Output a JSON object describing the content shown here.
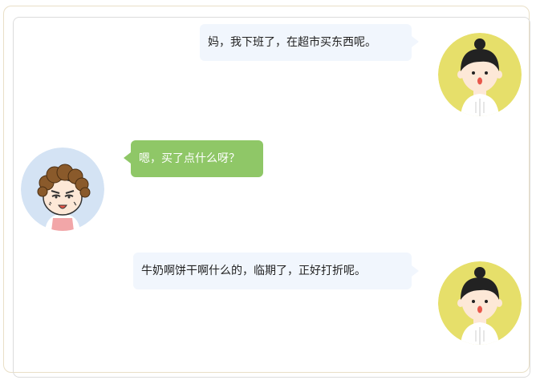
{
  "messages": [
    {
      "sender": "daughter",
      "side": "right",
      "text": "妈，我下班了，在超市买东西呢。"
    },
    {
      "sender": "mother",
      "side": "left",
      "text": "嗯，买了点什么呀？"
    },
    {
      "sender": "daughter",
      "side": "right",
      "text": "牛奶啊饼干啊什么的，临期了，正好打折呢。"
    }
  ],
  "colors": {
    "right_bubble": "#f1f6fd",
    "left_bubble": "#8fc767",
    "daughter_avatar_bg": "#e6df6a",
    "mother_avatar_bg": "#d4e3f4"
  }
}
